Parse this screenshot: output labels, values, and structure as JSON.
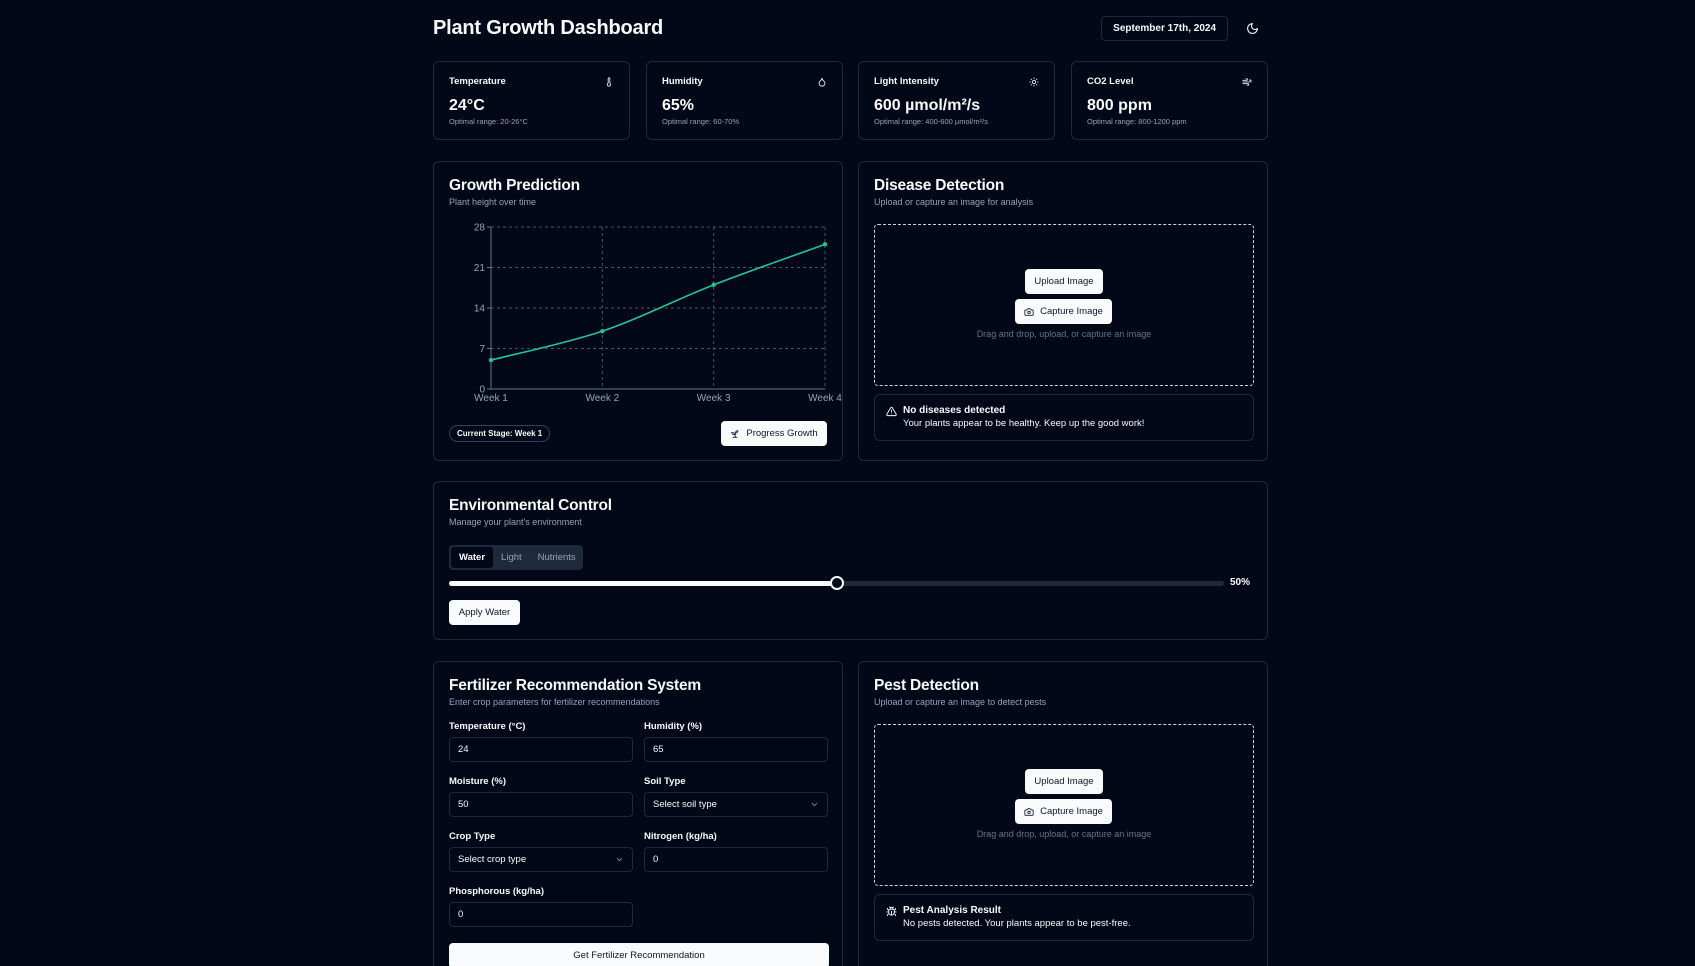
{
  "header": {
    "title": "Plant Growth Dashboard",
    "date": "September 17th, 2024",
    "theme_icon": "moon-icon"
  },
  "stats": [
    {
      "label": "Temperature",
      "value": "24°C",
      "range": "Optimal range: 20-26°C",
      "icon": "thermometer-icon"
    },
    {
      "label": "Humidity",
      "value": "65%",
      "range": "Optimal range: 60-70%",
      "icon": "droplet-icon"
    },
    {
      "label": "Light Intensity",
      "value": "600 µmol/m²/s",
      "range": "Optimal range: 400-600 µmol/m²/s",
      "icon": "sun-icon"
    },
    {
      "label": "CO2 Level",
      "value": "800 ppm",
      "range": "Optimal range: 800-1200 ppm",
      "icon": "wind-icon"
    }
  ],
  "growth": {
    "title": "Growth Prediction",
    "subtitle": "Plant height over time",
    "stage": "Current Stage: Week 1",
    "progress_button": "Progress Growth",
    "line_color": "#22c39a"
  },
  "chart_data": {
    "type": "line",
    "categories": [
      "Week 1",
      "Week 2",
      "Week 3",
      "Week 4"
    ],
    "series": [
      {
        "values": [
          5,
          10,
          18,
          25
        ]
      }
    ],
    "yticks": [
      0,
      7,
      14,
      21,
      28
    ],
    "ylim": [
      0,
      28
    ],
    "grid": true,
    "title": "",
    "xlabel": "",
    "ylabel": ""
  },
  "disease": {
    "title": "Disease Detection",
    "subtitle": "Upload or capture an image for analysis",
    "upload_button": "Upload Image",
    "capture_button": "Capture Image",
    "hint": "Drag and drop, upload, or capture an image",
    "result_title": "No diseases detected",
    "result_desc": "Your plants appear to be healthy. Keep up the good work!"
  },
  "environment": {
    "title": "Environmental Control",
    "subtitle": "Manage your plant's environment",
    "tabs": [
      "Water",
      "Light",
      "Nutrients"
    ],
    "active_tab": "Water",
    "level": 50,
    "level_label": "50%",
    "apply_button": "Apply Water"
  },
  "fertilizer": {
    "title": "Fertilizer Recommendation System",
    "subtitle": "Enter crop parameters for fertilizer recommendations",
    "fields": {
      "temperature": {
        "label": "Temperature (°C)",
        "value": "24"
      },
      "humidity": {
        "label": "Humidity (%)",
        "value": "65"
      },
      "moisture": {
        "label": "Moisture (%)",
        "value": "50"
      },
      "soil": {
        "label": "Soil Type",
        "value": "Select soil type"
      },
      "crop": {
        "label": "Crop Type",
        "value": "Select crop type"
      },
      "nitrogen": {
        "label": "Nitrogen (kg/ha)",
        "value": "0"
      },
      "phosphorous": {
        "label": "Phosphorous (kg/ha)",
        "value": "0"
      }
    },
    "submit_button": "Get Fertilizer Recommendation"
  },
  "pest": {
    "title": "Pest Detection",
    "subtitle": "Upload or capture an image to detect pests",
    "upload_button": "Upload Image",
    "capture_button": "Capture Image",
    "hint": "Drag and drop, upload, or capture an image",
    "result_title": "Pest Analysis Result",
    "result_desc": "No pests detected. Your plants appear to be pest-free."
  }
}
